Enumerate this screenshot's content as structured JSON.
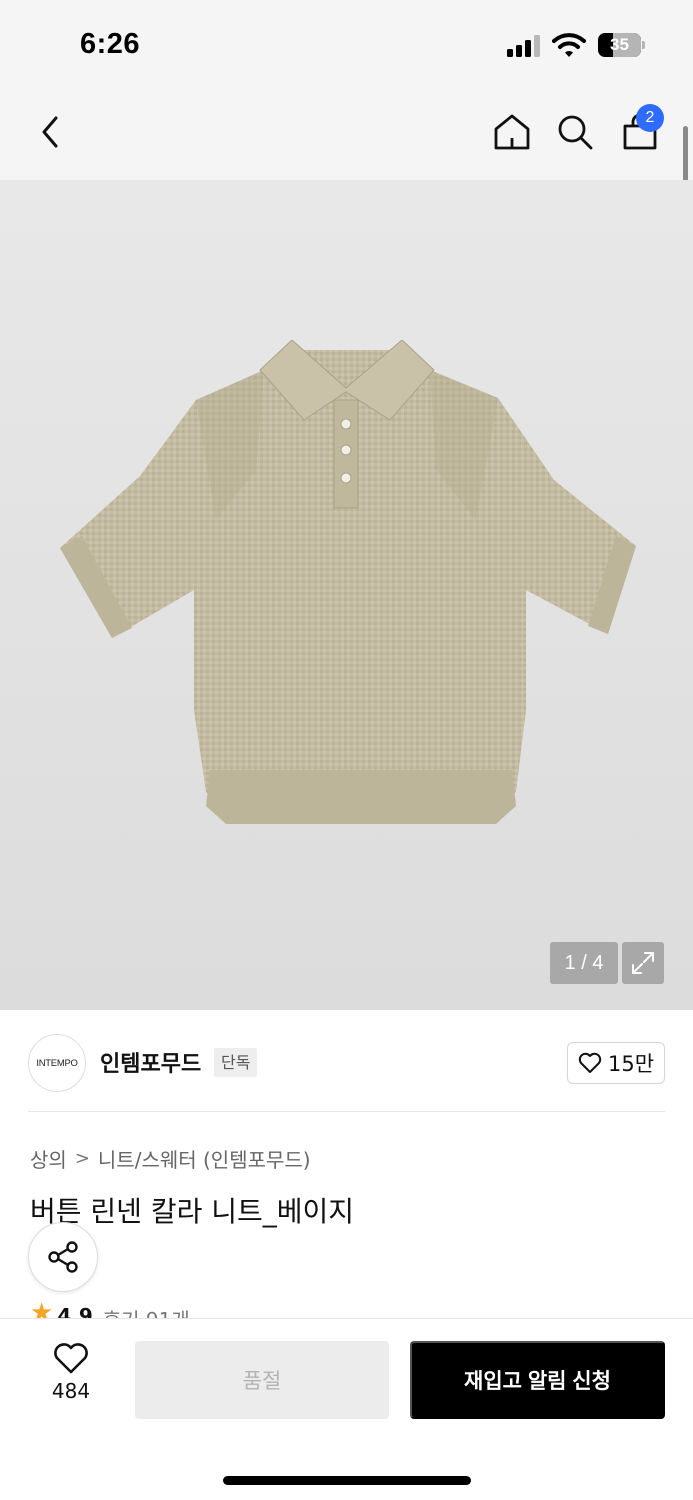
{
  "status_bar": {
    "time": "6:26",
    "battery_level": "35",
    "icons": [
      "signal-icon",
      "wifi-icon",
      "battery-icon"
    ]
  },
  "nav": {
    "icons": [
      "back-chevron-icon",
      "home-icon",
      "search-icon",
      "shopping-bag-icon"
    ],
    "cart_count": "2"
  },
  "gallery": {
    "page_indicator": "1 / 4",
    "total_images": 4,
    "current_image": 1,
    "icons": [
      "expand-icon"
    ]
  },
  "brand": {
    "logo_text": "INTEMPO",
    "name": "인템포무드",
    "tag": "단독",
    "likes": "15만",
    "icons": [
      "heart-outline-icon"
    ]
  },
  "product": {
    "breadcrumb": {
      "category": "상의",
      "separator": ">",
      "subcategory": "니트/스웨터 (인템포무드)"
    },
    "title": "버튼 린넨 칼라 니트_베이지",
    "rating": "4.9",
    "reviews": "후기 91개",
    "icons": [
      "share-icon",
      "star-icon"
    ]
  },
  "bottom_bar": {
    "wish_count": "484",
    "soldout_label": "품절",
    "restock_label": "재입고 알림 신청",
    "icons": [
      "heart-outline-icon"
    ]
  },
  "colors": {
    "accent_blue": "#2f6bff",
    "primary_black": "#000000",
    "disabled_gray": "#ececec",
    "star_orange": "#f5a623"
  }
}
